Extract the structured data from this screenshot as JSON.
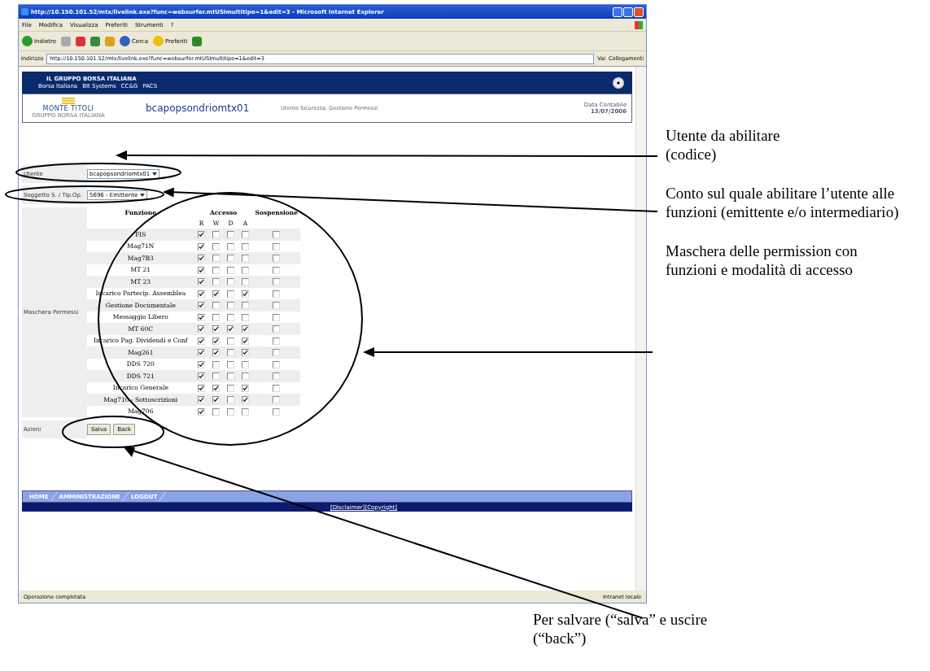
{
  "window": {
    "title": "http://10.150.101.52/mtx/livelink.exe?func=websurfer.mtUSImultitipo=1&edit=3 - Microsoft Internet Explorer"
  },
  "menu": [
    "File",
    "Modifica",
    "Visualizza",
    "Preferiti",
    "Strumenti",
    "?"
  ],
  "toolbar": [
    {
      "kind": "back",
      "label": "Indietro"
    },
    {
      "kind": "forward"
    },
    {
      "kind": "stop"
    },
    {
      "kind": "refresh"
    },
    {
      "kind": "home"
    },
    {
      "kind": "search",
      "label": "Cerca"
    },
    {
      "kind": "favorites",
      "label": "Preferiti"
    },
    {
      "kind": "history"
    }
  ],
  "address": {
    "label": "Indirizzo",
    "value": "http://10.150.101.52/mtx/livelink.exe?func=websurfer.mtUSImultitipo=1&edit=3",
    "go": "Vai",
    "links": "Collegamenti"
  },
  "site_header": {
    "group": "IL GRUPPO BORSA ITALIANA",
    "links": [
      "Borsa Italiana",
      "BIt Systems",
      "CC&G",
      "PACS"
    ],
    "logo": "MONTE TITOLI",
    "logo_sub": "GRUPPO BORSA ITALIANA",
    "user": "bcapopsondriomtx01",
    "section": "Utente Sicurezza: Gestione Permessi",
    "date_label": "Data Contabile",
    "date": "13/07/2006"
  },
  "form": {
    "user_label": "Utente",
    "user_value": "bcapopsondriomtx01",
    "subject_label": "Soggetto S. / Tip.Op.",
    "subject_value": "5696 - Emittente",
    "mask_label": "Maschera Permessi",
    "actions_label": "Azioni",
    "buttons": [
      "Salva",
      "Back"
    ]
  },
  "table": {
    "columns": {
      "function": "Funzione",
      "access": "Accesso",
      "suspension": "Sospensione"
    },
    "access_modes": [
      "R",
      "W",
      "D",
      "A"
    ],
    "rows": [
      {
        "function": "FIS",
        "access": [
          true,
          false,
          false,
          false
        ],
        "suspended": false
      },
      {
        "function": "Mag71N",
        "access": [
          true,
          false,
          false,
          false
        ],
        "suspended": false
      },
      {
        "function": "Mag7B3",
        "access": [
          true,
          false,
          false,
          false
        ],
        "suspended": false
      },
      {
        "function": "MT 21",
        "access": [
          true,
          false,
          false,
          false
        ],
        "suspended": false
      },
      {
        "function": "MT 23",
        "access": [
          true,
          false,
          false,
          false
        ],
        "suspended": false
      },
      {
        "function": "Incarico Partecip. Assemblea",
        "access": [
          true,
          true,
          false,
          true
        ],
        "suspended": false
      },
      {
        "function": "Gestione Documentale",
        "access": [
          true,
          false,
          false,
          false
        ],
        "suspended": false
      },
      {
        "function": "Messaggio Libero",
        "access": [
          true,
          false,
          false,
          false
        ],
        "suspended": false
      },
      {
        "function": "MT 60C",
        "access": [
          true,
          true,
          true,
          true
        ],
        "suspended": false
      },
      {
        "function": "Incarico Pag. Dividendi e Conf",
        "access": [
          true,
          true,
          false,
          true
        ],
        "suspended": false
      },
      {
        "function": "Mag261",
        "access": [
          true,
          true,
          false,
          true
        ],
        "suspended": false
      },
      {
        "function": "DDS 720",
        "access": [
          true,
          false,
          false,
          false
        ],
        "suspended": false
      },
      {
        "function": "DDS 721",
        "access": [
          true,
          false,
          false,
          false
        ],
        "suspended": false
      },
      {
        "function": "Incarico Generale",
        "access": [
          true,
          true,
          false,
          true
        ],
        "suspended": false
      },
      {
        "function": "Mag710 - Sottoscrizioni",
        "access": [
          true,
          true,
          false,
          true
        ],
        "suspended": false
      },
      {
        "function": "Mag706",
        "access": [
          true,
          false,
          false,
          false
        ],
        "suspended": false
      }
    ]
  },
  "footer": {
    "nav": [
      "HOME",
      "AMMINISTRAZIONE",
      "LOGOUT"
    ],
    "links": [
      "[Disclaimer]",
      "[Copyright]"
    ]
  },
  "status_bar": {
    "text": "Operazione completata",
    "zone": "Intranet locale"
  },
  "annotations": [
    "Utente da abilitare (codice)",
    "Conto sul quale abilitare l’utente alle funzioni (emittente e/o intermediario)",
    "Maschera delle permission con funzioni e modalità di accesso",
    "Per salvare (“salva” e uscire (“back”)"
  ]
}
